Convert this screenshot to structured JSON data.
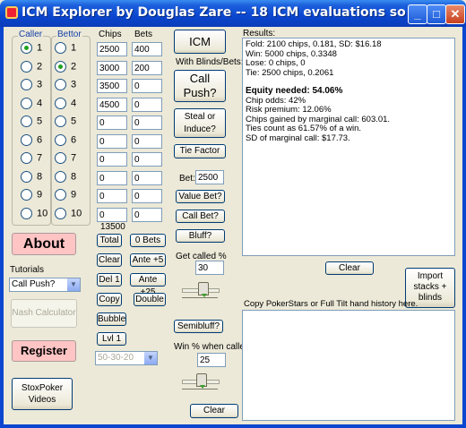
{
  "window": {
    "title": "ICM Explorer by Douglas Zare -- 18 ICM evaluations so far."
  },
  "title_buttons": {
    "minimize": "_",
    "maximize": "□",
    "close": "✕"
  },
  "caller": {
    "label": "Caller",
    "options": [
      "1",
      "2",
      "3",
      "4",
      "5",
      "6",
      "7",
      "8",
      "9",
      "10"
    ],
    "selected": "1"
  },
  "bettor": {
    "label": "Bettor",
    "options": [
      "1",
      "2",
      "3",
      "4",
      "5",
      "6",
      "7",
      "8",
      "9",
      "10"
    ],
    "selected": "2"
  },
  "columns": {
    "chips": "Chips",
    "bets": "Bets"
  },
  "rows": [
    {
      "chips": "2500",
      "bets": "400"
    },
    {
      "chips": "3000",
      "bets": "200"
    },
    {
      "chips": "3500",
      "bets": "0"
    },
    {
      "chips": "4500",
      "bets": "0"
    },
    {
      "chips": "0",
      "bets": "0"
    },
    {
      "chips": "0",
      "bets": "0"
    },
    {
      "chips": "0",
      "bets": "0"
    },
    {
      "chips": "0",
      "bets": "0"
    },
    {
      "chips": "0",
      "bets": "0"
    },
    {
      "chips": "0",
      "bets": "0"
    }
  ],
  "total_chips": "13500",
  "buttons": {
    "total": "Total",
    "zero_bets": "0 Bets",
    "clear": "Clear",
    "ante5": "Ante +5",
    "del1": "Del 1",
    "ante25": "Ante +25",
    "copy": "Copy",
    "double": "Double",
    "bubble": "Bubble",
    "lvl1": "Lvl 1",
    "icm": "ICM",
    "with_blinds": "With Blinds/Bets:",
    "call_push": "Call Push?",
    "steal": "Steal or Induce?",
    "tie_factor": "Tie Factor",
    "value_bet": "Value Bet?",
    "call_bet": "Call Bet?",
    "bluff": "Bluff?",
    "semibluff": "Semibluff?",
    "clear_bottom": "Clear",
    "clear_results": "Clear",
    "import": "Import stacks + blinds",
    "about": "About",
    "nash": "Nash Calculator",
    "register": "Register",
    "videos": "StoxPoker Videos"
  },
  "structure_select": {
    "value": "50-30-20"
  },
  "bet": {
    "label": "Bet:",
    "value": "2500"
  },
  "get_called": {
    "label": "Get called %",
    "value": "30",
    "fraction": 0.3
  },
  "win_when_called": {
    "label": "Win % when called",
    "value": "25",
    "fraction": 0.25
  },
  "tutorials": {
    "label": "Tutorials",
    "value": "Call Push?"
  },
  "results": {
    "label": "Results:",
    "lines_a": [
      "Fold: 2100 chips, 0.181, SD: $16.18",
      "Win: 5000 chips, 0.3348",
      "Lose: 0 chips, 0",
      "Tie: 2500 chips, 0.2061"
    ],
    "equity_needed": "Equity needed: 54.06%",
    "lines_b": [
      "Chip odds: 42%",
      "Risk premium: 12.06%",
      "Chips gained by marginal call: 603.01.",
      "Ties count as 61.57% of a win.",
      "SD of marginal call: $17.73."
    ]
  },
  "paste_label": "Copy PokerStars or Full Tilt hand history here.",
  "colors": {
    "title_bar": "#0a46d0",
    "pink_button": "#ffc4c4",
    "radio_on": "#21a121"
  }
}
